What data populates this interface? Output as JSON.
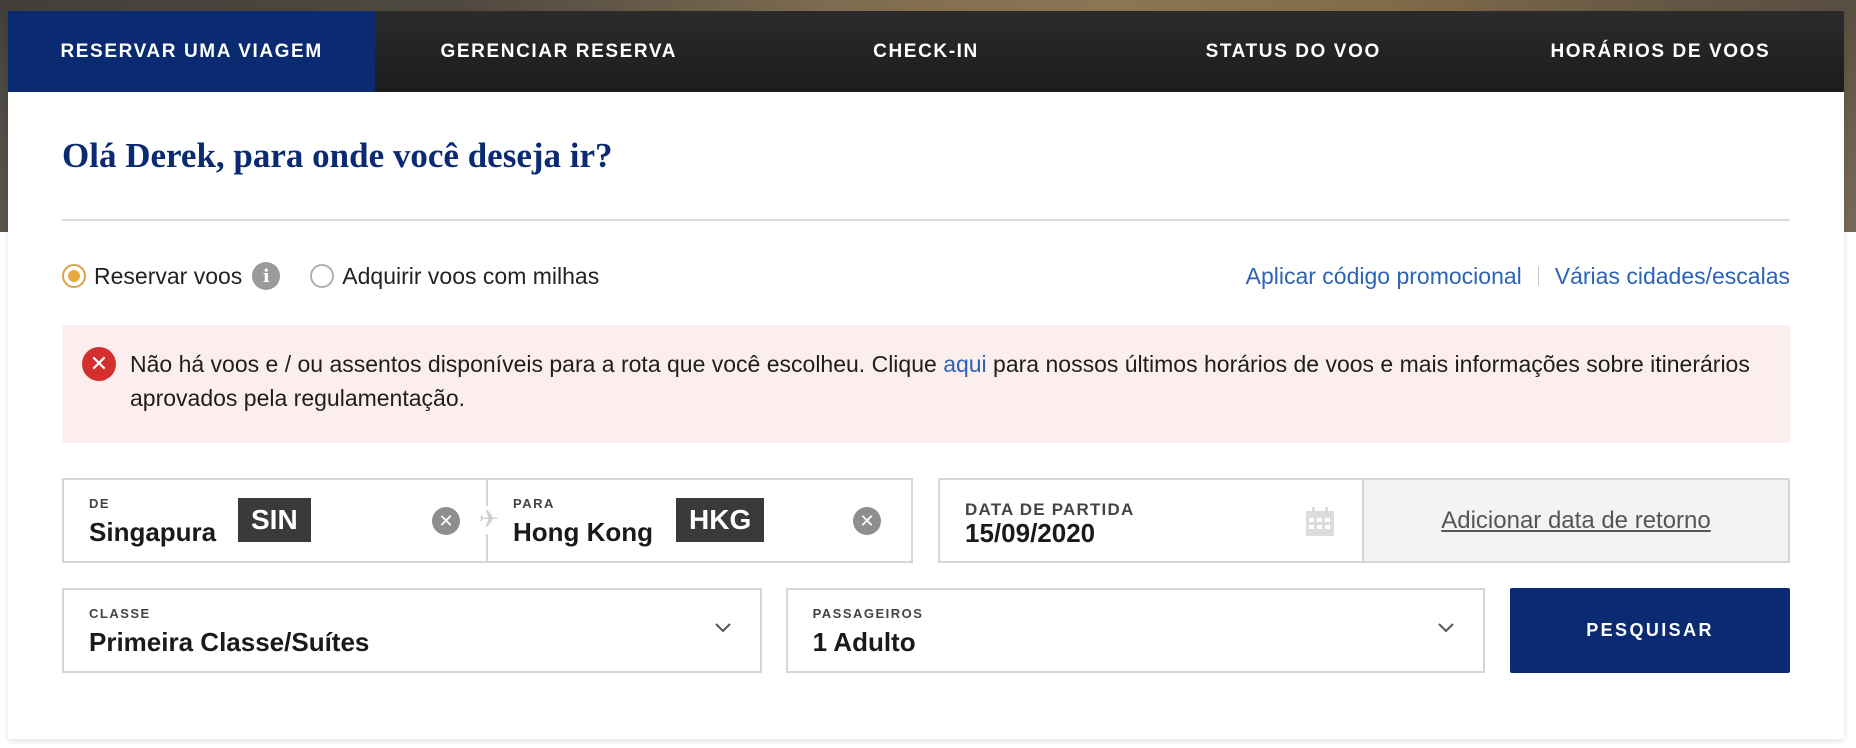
{
  "nav": {
    "tabs": [
      {
        "label": "RESERVAR UMA VIAGEM",
        "active": true
      },
      {
        "label": "GERENCIAR RESERVA",
        "active": false
      },
      {
        "label": "CHECK-IN",
        "active": false
      },
      {
        "label": "STATUS DO VOO",
        "active": false
      },
      {
        "label": "HORÁRIOS DE VOOS",
        "active": false
      }
    ]
  },
  "greeting": "Olá Derek, para onde você deseja ir?",
  "options": {
    "radio_book": {
      "label": "Reservar voos",
      "checked": true
    },
    "radio_miles": {
      "label": "Adquirir voos com milhas",
      "checked": false
    },
    "info_icon": "i",
    "promo_link": "Aplicar código promocional",
    "multi_city_link": "Várias cidades/escalas"
  },
  "alert": {
    "icon": "✕",
    "text_before": "Não há voos e / ou assentos disponíveis para a rota que você escolheu. Clique ",
    "link": "aqui",
    "text_after": " para nossos últimos horários de voos e mais informações sobre itinerários aprovados pela regulamentação."
  },
  "from": {
    "label": "DE",
    "city": "Singapura",
    "code": "SIN"
  },
  "to": {
    "label": "PARA",
    "city": "Hong Kong",
    "code": "HKG"
  },
  "departure": {
    "label": "DATA DE PARTIDA",
    "value": "15/09/2020"
  },
  "return_link": "Adicionar data de retorno",
  "class_field": {
    "label": "CLASSE",
    "value": "Primeira Classe/Suítes"
  },
  "passengers": {
    "label": "PASSAGEIROS",
    "value": "1 Adulto"
  },
  "search_button": "PESQUISAR",
  "colors": {
    "brand_navy": "#0a2a72",
    "link_blue": "#2b63b6",
    "alert_bg": "#fbeeec",
    "alert_red": "#d32f2f",
    "radio_orange": "#e8a940"
  },
  "icons": {
    "clear": "close-circle-icon",
    "plane": "airplane-icon",
    "calendar": "calendar-icon",
    "chevron": "chevron-down-icon",
    "info": "info-icon",
    "error": "error-icon"
  }
}
